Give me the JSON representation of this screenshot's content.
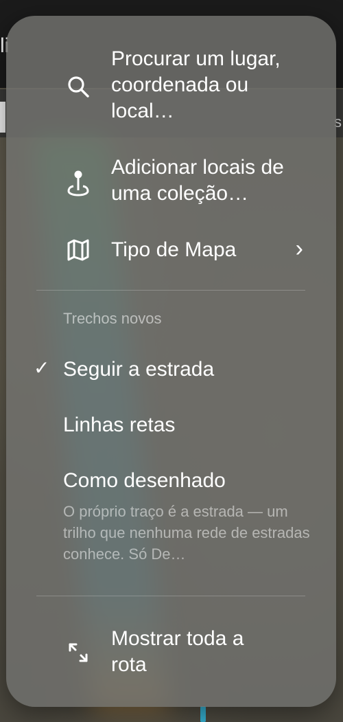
{
  "background": {
    "edge_text_left": "li",
    "edge_text_right": "s"
  },
  "menu": {
    "search": {
      "label": "Procurar um lugar, coordenada ou local…",
      "icon": "search-icon"
    },
    "collection": {
      "label": "Adicionar locais de uma coleção…",
      "icon": "pin-icon"
    },
    "map_type": {
      "label": "Tipo de Mapa",
      "icon": "map-icon",
      "chevron": "›"
    },
    "segments": {
      "header": "Trechos novos",
      "options": [
        {
          "label": "Seguir a estrada",
          "selected": true
        },
        {
          "label": "Linhas retas",
          "selected": false
        },
        {
          "label": "Como desenhado",
          "selected": false,
          "description": "O próprio traço é a estrada — um trilho que nenhuma rede de estradas conhece. Só De…"
        }
      ],
      "checkmark": "✓"
    },
    "show_route": {
      "label": "Mostrar toda a rota",
      "icon": "expand-arrows-icon"
    }
  },
  "colors": {
    "menu_background": "#70706c",
    "route_accent": "#36b3d4"
  }
}
